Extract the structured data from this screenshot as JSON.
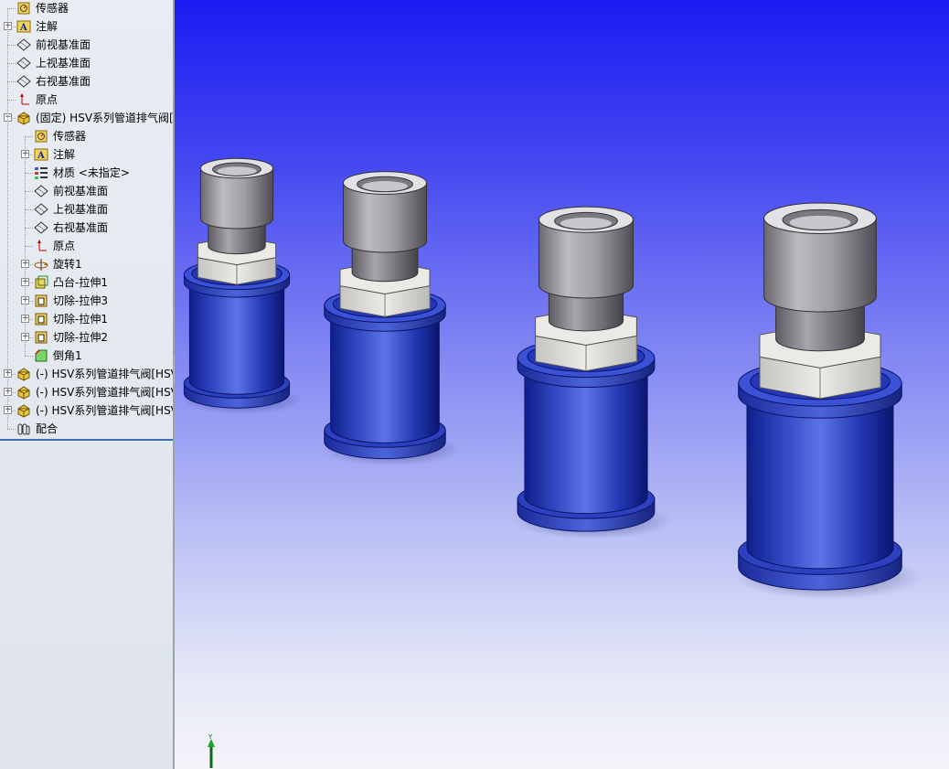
{
  "feature_tree": {
    "items": [
      {
        "label": "传感器",
        "icon": "sensor-icon",
        "level": 0,
        "toggle": ""
      },
      {
        "label": "注解",
        "icon": "annotation-icon",
        "level": 0,
        "toggle": "+"
      },
      {
        "label": "前视基准面",
        "icon": "plane-icon",
        "level": 0,
        "toggle": ""
      },
      {
        "label": "上视基准面",
        "icon": "plane-icon",
        "level": 0,
        "toggle": ""
      },
      {
        "label": "右视基准面",
        "icon": "plane-icon",
        "level": 0,
        "toggle": ""
      },
      {
        "label": "原点",
        "icon": "origin-icon",
        "level": 0,
        "toggle": ""
      },
      {
        "label": "(固定) HSV系列管道排气阀[H",
        "icon": "part-icon",
        "level": 0,
        "toggle": "-"
      },
      {
        "label": "传感器",
        "icon": "sensor-icon",
        "level": 1,
        "toggle": ""
      },
      {
        "label": "注解",
        "icon": "annotation-icon",
        "level": 1,
        "toggle": "+"
      },
      {
        "label": "材质 <未指定>",
        "icon": "material-icon",
        "level": 1,
        "toggle": ""
      },
      {
        "label": "前视基准面",
        "icon": "plane-icon",
        "level": 1,
        "toggle": ""
      },
      {
        "label": "上视基准面",
        "icon": "plane-icon",
        "level": 1,
        "toggle": ""
      },
      {
        "label": "右视基准面",
        "icon": "plane-icon",
        "level": 1,
        "toggle": ""
      },
      {
        "label": "原点",
        "icon": "origin-icon",
        "level": 1,
        "toggle": ""
      },
      {
        "label": "旋转1",
        "icon": "revolve-icon",
        "level": 1,
        "toggle": "+"
      },
      {
        "label": "凸台-拉伸1",
        "icon": "boss-extrude-icon",
        "level": 1,
        "toggle": "+"
      },
      {
        "label": "切除-拉伸3",
        "icon": "cut-extrude-icon",
        "level": 1,
        "toggle": "+"
      },
      {
        "label": "切除-拉伸1",
        "icon": "cut-extrude-icon",
        "level": 1,
        "toggle": "+"
      },
      {
        "label": "切除-拉伸2",
        "icon": "cut-extrude-icon",
        "level": 1,
        "toggle": "+"
      },
      {
        "label": "倒角1",
        "icon": "chamfer-icon",
        "level": 1,
        "toggle": ""
      },
      {
        "label": "(-) HSV系列管道排气阀[HSV",
        "icon": "part-icon",
        "level": 0,
        "toggle": "+"
      },
      {
        "label": "(-) HSV系列管道排气阀[HSV",
        "icon": "part-icon",
        "level": 0,
        "toggle": "+"
      },
      {
        "label": "(-) HSV系列管道排气阀[HSV",
        "icon": "part-icon",
        "level": 0,
        "toggle": "+"
      },
      {
        "label": "配合",
        "icon": "mates-icon",
        "level": 0,
        "toggle": ""
      }
    ]
  },
  "collapse_handle": {
    "icon": "collapse-arrows-icon"
  },
  "graphics_area": {
    "background_top": "#1b1cf2",
    "background_bottom": "#f4f4fa",
    "body_color": "#2a3fc8",
    "nut_color": "#dcdcda",
    "sleeve_color": "#9c9aa0",
    "models": [
      "HSV系列管道排气阀",
      "HSV系列管道排气阀",
      "HSV系列管道排气阀",
      "HSV系列管道排气阀"
    ],
    "triad_label": "Y"
  }
}
